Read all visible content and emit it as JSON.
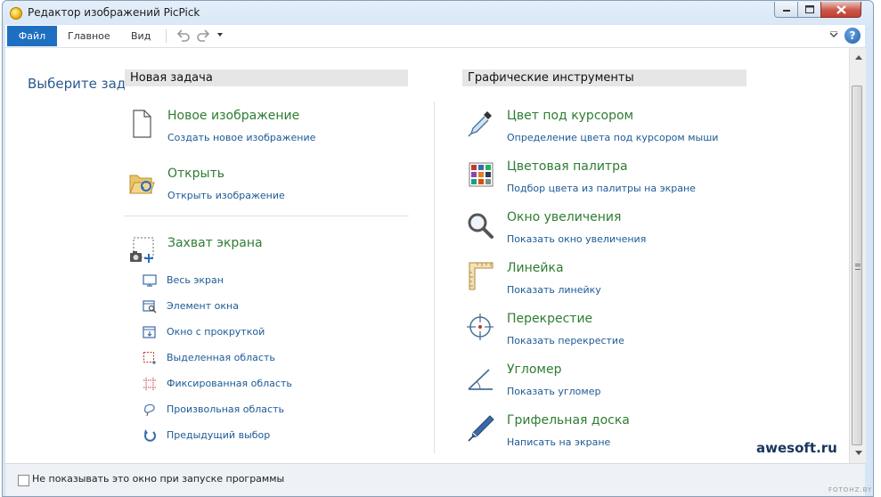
{
  "window": {
    "title": "Редактор изображений PicPick",
    "controls": {
      "minimize": "minimize-icon",
      "maximize": "maximize-icon",
      "close": "close-icon"
    }
  },
  "ribbon": {
    "file_tab": "Файл",
    "tabs": [
      "Главное",
      "Вид"
    ],
    "quick_access": [
      "undo-icon",
      "redo-icon",
      "dropdown-icon"
    ],
    "help_label": "?"
  },
  "main": {
    "choose_text": "Выберите зада"
  },
  "new_task": {
    "header": "Новая задача",
    "items": [
      {
        "title": "Новое изображение",
        "subtitle": "Создать новое изображение",
        "icon": "new-document-icon"
      },
      {
        "title": "Открыть",
        "subtitle": "Открыть изображение",
        "icon": "open-folder-icon"
      },
      {
        "title": "Захват экрана",
        "subtitle": "",
        "icon": "screen-capture-icon"
      }
    ],
    "capture_options": [
      {
        "label": "Весь экран",
        "icon": "monitor-icon"
      },
      {
        "label": "Элемент окна",
        "icon": "window-element-icon"
      },
      {
        "label": "Окно с прокруткой",
        "icon": "scroll-window-icon"
      },
      {
        "label": "Выделенная область",
        "icon": "selected-region-icon"
      },
      {
        "label": "Фиксированная область",
        "icon": "fixed-region-icon"
      },
      {
        "label": "Произвольная область",
        "icon": "freehand-region-icon"
      },
      {
        "label": "Предыдущий выбор",
        "icon": "previous-selection-icon"
      }
    ]
  },
  "graphic_tools": {
    "header": "Графические инструменты",
    "items": [
      {
        "title": "Цвет под курсором",
        "subtitle": "Определение цвета под курсором мыши",
        "icon": "color-picker-icon"
      },
      {
        "title": "Цветовая палитра",
        "subtitle": "Подбор цвета из палитры на экране",
        "icon": "color-palette-icon"
      },
      {
        "title": "Окно увеличения",
        "subtitle": "Показать окно увеличения",
        "icon": "magnifier-icon"
      },
      {
        "title": "Линейка",
        "subtitle": "Показать линейку",
        "icon": "ruler-icon"
      },
      {
        "title": "Перекрестие",
        "subtitle": "Показать перекрестие",
        "icon": "crosshair-icon"
      },
      {
        "title": "Угломер",
        "subtitle": "Показать угломер",
        "icon": "protractor-icon"
      },
      {
        "title": "Грифельная доска",
        "subtitle": "Написать на экране",
        "icon": "whiteboard-pen-icon"
      }
    ]
  },
  "status": {
    "checkbox_label": "Не показывать это окно при запуске программы"
  },
  "watermark": "awesoft.ru",
  "corner_watermark": "FOTOHZ.BY"
}
